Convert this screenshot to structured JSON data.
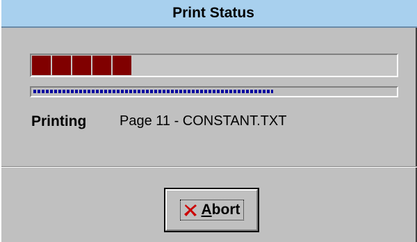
{
  "window": {
    "title": "Print Status"
  },
  "progress": {
    "blocks_filled": 5,
    "fraction": 0.29,
    "color": "#800000"
  },
  "secondary_progress": {
    "fraction": 0.66,
    "color": "#0000a0"
  },
  "status": {
    "label": "Printing",
    "value": "Page 11 - CONSTANT.TXT"
  },
  "abort_button": {
    "label": "Abort",
    "mnemonic": "A",
    "icon": "red-x-icon",
    "icon_color": "#cc0000"
  }
}
